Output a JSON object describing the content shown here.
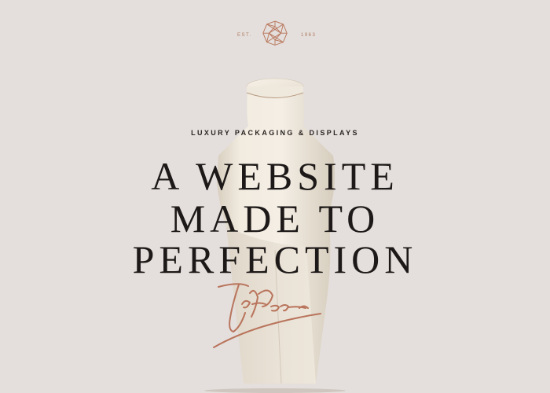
{
  "brand": {
    "est_left": "EST.",
    "est_right": "1963",
    "logo_icon": "geometric-crystal-logo-icon",
    "accent_color": "#b07a61"
  },
  "hero": {
    "eyebrow": "LUXURY PACKAGING & DISPLAYS",
    "headline_lines": [
      "A WEBSITE",
      "MADE TO",
      "PERFECTION"
    ]
  },
  "signature": {
    "icon": "handwritten-signature-icon",
    "color": "#b9745c"
  },
  "colors": {
    "background": "#e4dfdc",
    "text": "#1d1918",
    "bust": "#eee7db"
  }
}
